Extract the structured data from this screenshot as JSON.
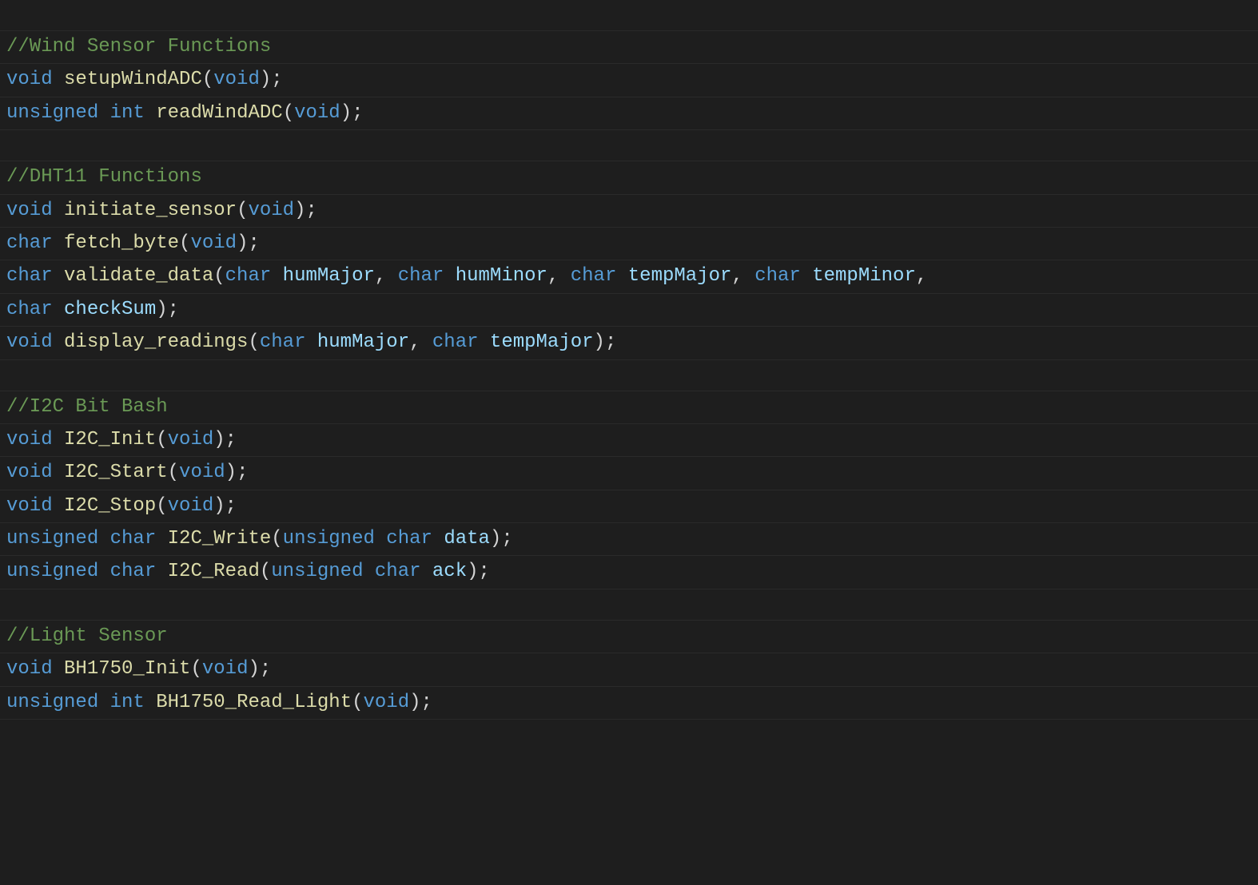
{
  "colors": {
    "background": "#1e1e1e",
    "comment": "#6a9955",
    "keyword": "#569cd6",
    "function": "#dcdcaa",
    "parameter": "#9cdcfe",
    "punctuation": "#d4d4d4"
  },
  "code": {
    "blank0": "",
    "comment1": "//Wind Sensor Functions",
    "line2": {
      "kw1": "void",
      "sp1": " ",
      "fn": "setupWindADC",
      "lp": "(",
      "kw2": "void",
      "rp": ")",
      "semi": ";"
    },
    "line3": {
      "kw1": "unsigned",
      "sp1": " ",
      "kw2": "int",
      "sp2": " ",
      "fn": "readWindADC",
      "lp": "(",
      "kw3": "void",
      "rp": ")",
      "semi": ";"
    },
    "blank4": "",
    "comment5": "//DHT11 Functions",
    "line6": {
      "kw1": "void",
      "sp1": " ",
      "fn": "initiate_sensor",
      "lp": "(",
      "kw2": "void",
      "rp": ")",
      "semi": ";"
    },
    "line7": {
      "kw1": "char",
      "sp1": " ",
      "fn": "fetch_byte",
      "lp": "(",
      "kw2": "void",
      "rp": ")",
      "semi": ";"
    },
    "line8": {
      "kw1": "char",
      "sp1": " ",
      "fn": "validate_data",
      "lp": "(",
      "kw2": "char",
      "sp2": " ",
      "p1": "humMajor",
      "c1": ",",
      "sp3": " ",
      "kw3": "char",
      "sp4": " ",
      "p2": "humMinor",
      "c2": ",",
      "sp5": " ",
      "kw4": "char",
      "sp6": " ",
      "p3": "tempMajor",
      "c3": ",",
      "sp7": " ",
      "kw5": "char",
      "sp8": " ",
      "p4": "tempMinor",
      "c4": ","
    },
    "line9": {
      "kw1": "char",
      "sp1": " ",
      "p1": "checkSum",
      "rp": ")",
      "semi": ";"
    },
    "line10": {
      "kw1": "void",
      "sp1": " ",
      "fn": "display_readings",
      "lp": "(",
      "kw2": "char",
      "sp2": " ",
      "p1": "humMajor",
      "c1": ",",
      "sp3": " ",
      "kw3": "char",
      "sp4": " ",
      "p2": "tempMajor",
      "rp": ")",
      "semi": ";"
    },
    "blank11": "",
    "comment12": "//I2C Bit Bash",
    "line13": {
      "kw1": "void",
      "sp1": " ",
      "fn": "I2C_Init",
      "lp": "(",
      "kw2": "void",
      "rp": ")",
      "semi": ";"
    },
    "line14": {
      "kw1": "void",
      "sp1": " ",
      "fn": "I2C_Start",
      "lp": "(",
      "kw2": "void",
      "rp": ")",
      "semi": ";"
    },
    "line15": {
      "kw1": "void",
      "sp1": " ",
      "fn": "I2C_Stop",
      "lp": "(",
      "kw2": "void",
      "rp": ")",
      "semi": ";"
    },
    "line16": {
      "kw1": "unsigned",
      "sp1": " ",
      "kw2": "char",
      "sp2": " ",
      "fn": "I2C_Write",
      "lp": "(",
      "kw3": "unsigned",
      "sp3": " ",
      "kw4": "char",
      "sp4": " ",
      "p1": "data",
      "rp": ")",
      "semi": ";"
    },
    "line17": {
      "kw1": "unsigned",
      "sp1": " ",
      "kw2": "char",
      "sp2": " ",
      "fn": "I2C_Read",
      "lp": "(",
      "kw3": "unsigned",
      "sp3": " ",
      "kw4": "char",
      "sp4": " ",
      "p1": "ack",
      "rp": ")",
      "semi": ";"
    },
    "blank18": "",
    "comment19": "//Light Sensor",
    "line20": {
      "kw1": "void",
      "sp1": " ",
      "fn": "BH1750_Init",
      "lp": "(",
      "kw2": "void",
      "rp": ")",
      "semi": ";"
    },
    "line21": {
      "kw1": "unsigned",
      "sp1": " ",
      "kw2": "int",
      "sp2": " ",
      "fn": "BH1750_Read_Light",
      "lp": "(",
      "kw3": "void",
      "rp": ")",
      "semi": ";"
    }
  }
}
